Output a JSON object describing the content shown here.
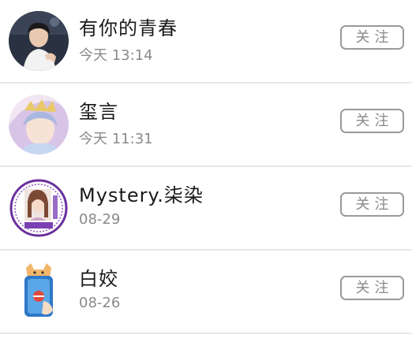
{
  "users": [
    {
      "name": "有你的青春",
      "time": "今天 13:14",
      "follow_label": "关注",
      "avatar_icon": "boy-photo-avatar"
    },
    {
      "name": "玺言",
      "time": "今天 11:31",
      "follow_label": "关注",
      "avatar_icon": "crowned-anime-avatar"
    },
    {
      "name": "Mystery.柒染",
      "time": "08-29",
      "follow_label": "关注",
      "avatar_icon": "purple-stamp-girl-avatar"
    },
    {
      "name": "白姣",
      "time": "08-26",
      "follow_label": "关注",
      "avatar_icon": "shiba-cup-avatar"
    }
  ],
  "colors": {
    "name_text": "#1a1a1a",
    "time_text": "#8a8a8a",
    "button_border": "#9a9a9a",
    "divider": "#e8e8e8"
  }
}
